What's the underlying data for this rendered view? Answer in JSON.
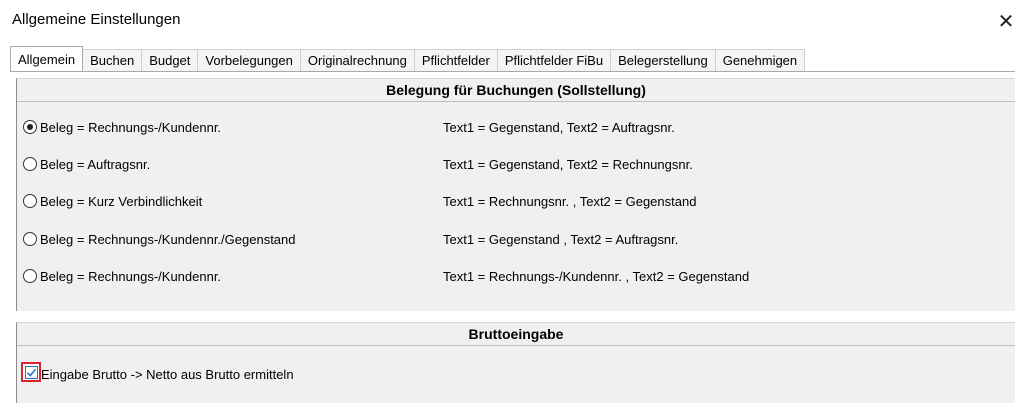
{
  "window": {
    "title": "Allgemeine Einstellungen",
    "close_glyph": "✕"
  },
  "tabs": [
    {
      "label": "Allgemein",
      "active": true
    },
    {
      "label": "Buchen"
    },
    {
      "label": "Budget"
    },
    {
      "label": "Vorbelegungen"
    },
    {
      "label": "Originalrechnung"
    },
    {
      "label": "Pflichtfelder"
    },
    {
      "label": "Pflichtfelder FiBu"
    },
    {
      "label": "Belegerstellung"
    },
    {
      "label": "Genehmigen"
    }
  ],
  "section1": {
    "header": "Belegung für Buchungen (Sollstellung)",
    "options": [
      {
        "label": "Beleg = Rechnungs-/Kundennr.",
        "text": "Text1 = Gegenstand, Text2 = Auftragsnr.",
        "selected": true
      },
      {
        "label": "Beleg = Auftragsnr.",
        "text": "Text1 = Gegenstand, Text2 = Rechnungsnr.",
        "selected": false
      },
      {
        "label": "Beleg = Kurz Verbindlichkeit",
        "text": "Text1 = Rechnungsnr. , Text2 = Gegenstand",
        "selected": false
      },
      {
        "label": "Beleg = Rechnungs-/Kundennr./Gegenstand",
        "text": "Text1 = Gegenstand , Text2 = Auftragsnr.",
        "selected": false
      },
      {
        "label": "Beleg = Rechnungs-/Kundennr.",
        "text": "Text1 = Rechnungs-/Kundennr. , Text2 = Gegenstand",
        "selected": false
      }
    ]
  },
  "section2": {
    "header": "Bruttoeingabe",
    "checkbox_label": "Eingabe Brutto -> Netto aus Brutto ermitteln",
    "checked": true
  },
  "colors": {
    "highlight": "#d9262c",
    "checkbox_blue": "#2b6fd1"
  }
}
